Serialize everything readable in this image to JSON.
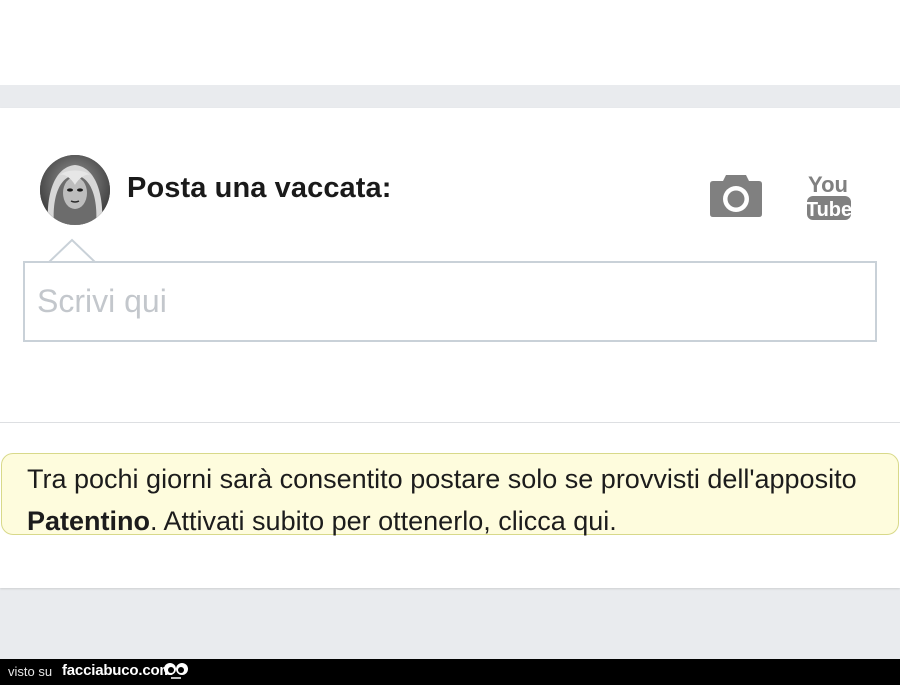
{
  "composer": {
    "title": "Posta una vaccata:",
    "input_placeholder": "Scrivi qui"
  },
  "icons": {
    "avatar": "user-avatar",
    "camera": "camera-icon",
    "youtube": "youtube-icon",
    "youtube_text_top": "You",
    "youtube_text_bottom": "Tube"
  },
  "notice": {
    "text_before": "Tra pochi giorni sarà consentito postare solo se provvisti dell'apposito",
    "highlight": "Patentino",
    "text_after": ". Attivati subito per ottenerlo, clicca qui."
  },
  "footer": {
    "seen_on": "visto su",
    "site_name": "facciabuco.com"
  },
  "colors": {
    "page_background": "#e9ebee",
    "card_background": "#ffffff",
    "notice_background": "#fefcdd",
    "notice_border": "#d8d98a",
    "icon_gray": "#808080",
    "footer_background": "#000000"
  }
}
